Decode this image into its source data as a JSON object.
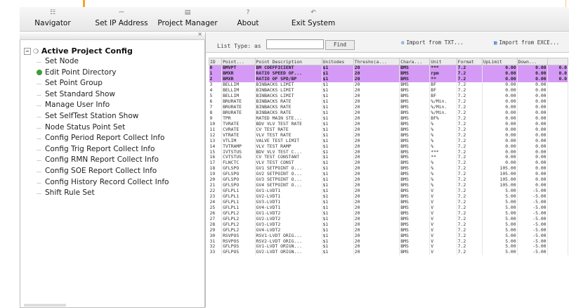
{
  "toolbar": {
    "buttons": [
      {
        "label": "Navigator",
        "icon": "navigator-icon"
      },
      {
        "label": "Set IP Address",
        "icon": "network-icon"
      },
      {
        "label": "Project Manager",
        "icon": "project-icon"
      },
      {
        "label": "About",
        "icon": "about-icon"
      },
      {
        "label": "Exit System",
        "icon": "exit-icon"
      }
    ]
  },
  "tree": {
    "root": "Active Project Config",
    "items": [
      {
        "label": "Set Node",
        "active": false
      },
      {
        "label": "Edit Point Directory",
        "active": true
      },
      {
        "label": "Set Point Group",
        "active": false
      },
      {
        "label": "Set Standard Show",
        "active": false
      },
      {
        "label": "Manage User Info",
        "active": false
      },
      {
        "label": "Set SelfTest Station Show",
        "active": false
      },
      {
        "label": "Node Status Point Set",
        "active": false
      },
      {
        "label": "Config Period Report Collect Info",
        "active": false
      },
      {
        "label": "Config Trig Report Collect Info",
        "active": false
      },
      {
        "label": "Config RMN Report Collect Info",
        "active": false
      },
      {
        "label": "Config SOE Report Collect Info",
        "active": false
      },
      {
        "label": "Config History Record Collect Info",
        "active": false
      },
      {
        "label": "Shift Rule Set",
        "active": false
      }
    ]
  },
  "filter": {
    "list_type_label": "List Type: as",
    "find_label": "Find",
    "import_1": "Import from TXT...",
    "import_2": "Import from EXCE..."
  },
  "grid": {
    "columns": [
      "ID",
      "Point...",
      "Point Description",
      "Unitodes",
      "Thresho(a...",
      "Chara...",
      "Unit",
      "Format",
      "UpLimit",
      "Down...",
      ""
    ],
    "rows": [
      [
        "0",
        "BMVPT",
        "BM COEFFICIENT",
        "$1",
        "20",
        "BMS",
        "***",
        "7.2",
        "0.00",
        "0.00",
        "0.0"
      ],
      [
        "1",
        "BMXR",
        "RATIO SPEED OF...",
        "$1",
        "20",
        "BMS",
        "rpm",
        "7.2",
        "0.00",
        "0.00",
        "0.0"
      ],
      [
        "2",
        "BMXR",
        "RATIO OF SPD/BP",
        "$1",
        "20",
        "BMS",
        "**",
        "7.2",
        "0.00",
        "0.00",
        "0.0"
      ],
      [
        "3",
        "BELLIM",
        "BINBACKS LIMIT",
        "$1",
        "20",
        "BMS",
        "BF",
        "7.2",
        "0.00",
        "0.00",
        ""
      ],
      [
        "4",
        "BELLIM",
        "BINBACKS LIMIT",
        "$1",
        "20",
        "BMS",
        "BF",
        "7.2",
        "0.00",
        "0.00",
        ""
      ],
      [
        "5",
        "BELLIM",
        "BINBACKS LIMIT",
        "$1",
        "20",
        "BMS",
        "BF",
        "7.2",
        "0.00",
        "0.00",
        ""
      ],
      [
        "6",
        "BRURATE",
        "BINBACKS RATE",
        "$1",
        "20",
        "BMS",
        "%/Min.",
        "7.2",
        "0.00",
        "0.00",
        ""
      ],
      [
        "7",
        "BRURATE",
        "BINBACKS RATE",
        "$1",
        "20",
        "BMS",
        "%/Min.",
        "7.2",
        "0.00",
        "0.00",
        ""
      ],
      [
        "8",
        "BRURATE",
        "BINBACKS RATE",
        "$1",
        "20",
        "BMS",
        "%/Min.",
        "7.2",
        "0.00",
        "0.00",
        ""
      ],
      [
        "9",
        "TPR",
        "RATED MAIN STE...",
        "$1",
        "20",
        "BMS",
        "BF%",
        "7.2",
        "0.00",
        "0.00",
        ""
      ],
      [
        "10",
        "TVRATE",
        "BDV VLV TEST RATE",
        "$1",
        "20",
        "BMS",
        "%",
        "7.2",
        "0.00",
        "0.00",
        ""
      ],
      [
        "11",
        "CVRATE",
        "CV TEST RATE",
        "$1",
        "20",
        "BMS",
        "%",
        "7.2",
        "0.00",
        "0.00",
        ""
      ],
      [
        "12",
        "VTRATE",
        "VLV TEST RATE",
        "$1",
        "20",
        "BMS",
        "%",
        "7.2",
        "0.00",
        "0.00",
        ""
      ],
      [
        "13",
        "VTLIM",
        "VALVE TEST LIMIT",
        "$1",
        "20",
        "BMS",
        "%",
        "7.2",
        "0.00",
        "0.00",
        ""
      ],
      [
        "14",
        "TVTRAMP",
        "VLV TEST RAMP",
        "$1",
        "20",
        "BMS",
        "%",
        "7.2",
        "0.00",
        "0.00",
        ""
      ],
      [
        "15",
        "IVTSTUS",
        "BDV VLV TEST C...",
        "$1",
        "20",
        "BMS",
        "***",
        "7.2",
        "0.00",
        "0.00",
        ""
      ],
      [
        "16",
        "CVTSTUS",
        "CV TEST CONSTANT",
        "$1",
        "20",
        "BMS",
        "**",
        "7.2",
        "0.00",
        "0.00",
        ""
      ],
      [
        "17",
        "FLNCTC",
        "VLV TEST CONST",
        "$1",
        "20",
        "BMS",
        "%",
        "7.2",
        "0.00",
        "0.00",
        ""
      ],
      [
        "18",
        "GFLSPO",
        "GV1 SETPOINT O...",
        "$1",
        "20",
        "BMS",
        "%",
        "7.2",
        "105.00",
        "0.00",
        ""
      ],
      [
        "19",
        "GFLSPO",
        "GV2 SETPOINT O...",
        "$1",
        "20",
        "BMS",
        "%",
        "7.2",
        "105.00",
        "0.00",
        ""
      ],
      [
        "20",
        "GFLSPO",
        "GV3 SETPOINT O...",
        "$1",
        "20",
        "BMS",
        "%",
        "7.2",
        "105.00",
        "0.00",
        ""
      ],
      [
        "21",
        "GFLSPO",
        "GV4 SETPOINT O...",
        "$1",
        "20",
        "BMS",
        "%",
        "7.2",
        "105.00",
        "0.00",
        ""
      ],
      [
        "22",
        "GFLPL1",
        "GV1-LVDT1",
        "$1",
        "20",
        "BMS",
        "V",
        "7.2",
        "5.00",
        "-5.00",
        ""
      ],
      [
        "23",
        "GFLPL1",
        "GV2-LVDT1",
        "$1",
        "20",
        "BMS",
        "V",
        "7.2",
        "5.00",
        "-5.00",
        ""
      ],
      [
        "24",
        "GFLPL1",
        "GV3-LVDT1",
        "$1",
        "20",
        "BMS",
        "V",
        "7.2",
        "5.00",
        "-5.00",
        ""
      ],
      [
        "25",
        "GFLPL1",
        "GV4-LVDT1",
        "$1",
        "20",
        "BMS",
        "V",
        "7.2",
        "5.00",
        "-5.00",
        ""
      ],
      [
        "26",
        "GFLPL2",
        "GV1-LVDT2",
        "$1",
        "20",
        "BMS",
        "V",
        "7.2",
        "5.00",
        "-5.00",
        ""
      ],
      [
        "27",
        "GFLPL2",
        "GV2-LVDT2",
        "$1",
        "20",
        "BMS",
        "V",
        "7.2",
        "5.00",
        "-5.00",
        ""
      ],
      [
        "28",
        "GFLPL2",
        "GV3-LVDT2",
        "$1",
        "20",
        "BMS",
        "V",
        "7.2",
        "5.00",
        "-5.00",
        ""
      ],
      [
        "29",
        "GFLPL2",
        "GV4-LVDT2",
        "$1",
        "20",
        "BMS",
        "V",
        "7.2",
        "5.00",
        "-5.00",
        ""
      ],
      [
        "30",
        "RSVPOS",
        "RSV1-LVDT ORIG...",
        "$1",
        "20",
        "BMS",
        "V",
        "7.2",
        "5.00",
        "-5.00",
        ""
      ],
      [
        "31",
        "RSVPOS",
        "RSV2-LVDT ORIG...",
        "$1",
        "20",
        "BMS",
        "V",
        "7.2",
        "5.00",
        "-5.00",
        ""
      ],
      [
        "32",
        "GFLPOS",
        "GV1-LVDT ORIGN...",
        "$1",
        "20",
        "BMS",
        "V",
        "7.2",
        "5.00",
        "-5.00",
        ""
      ],
      [
        "33",
        "GFLPOS",
        "GV2-LVDT ORIGN...",
        "$1",
        "20",
        "BMS",
        "V",
        "7.2",
        "5.00",
        "-5.00",
        ""
      ]
    ],
    "selected_rows": [
      0,
      1,
      2
    ]
  }
}
